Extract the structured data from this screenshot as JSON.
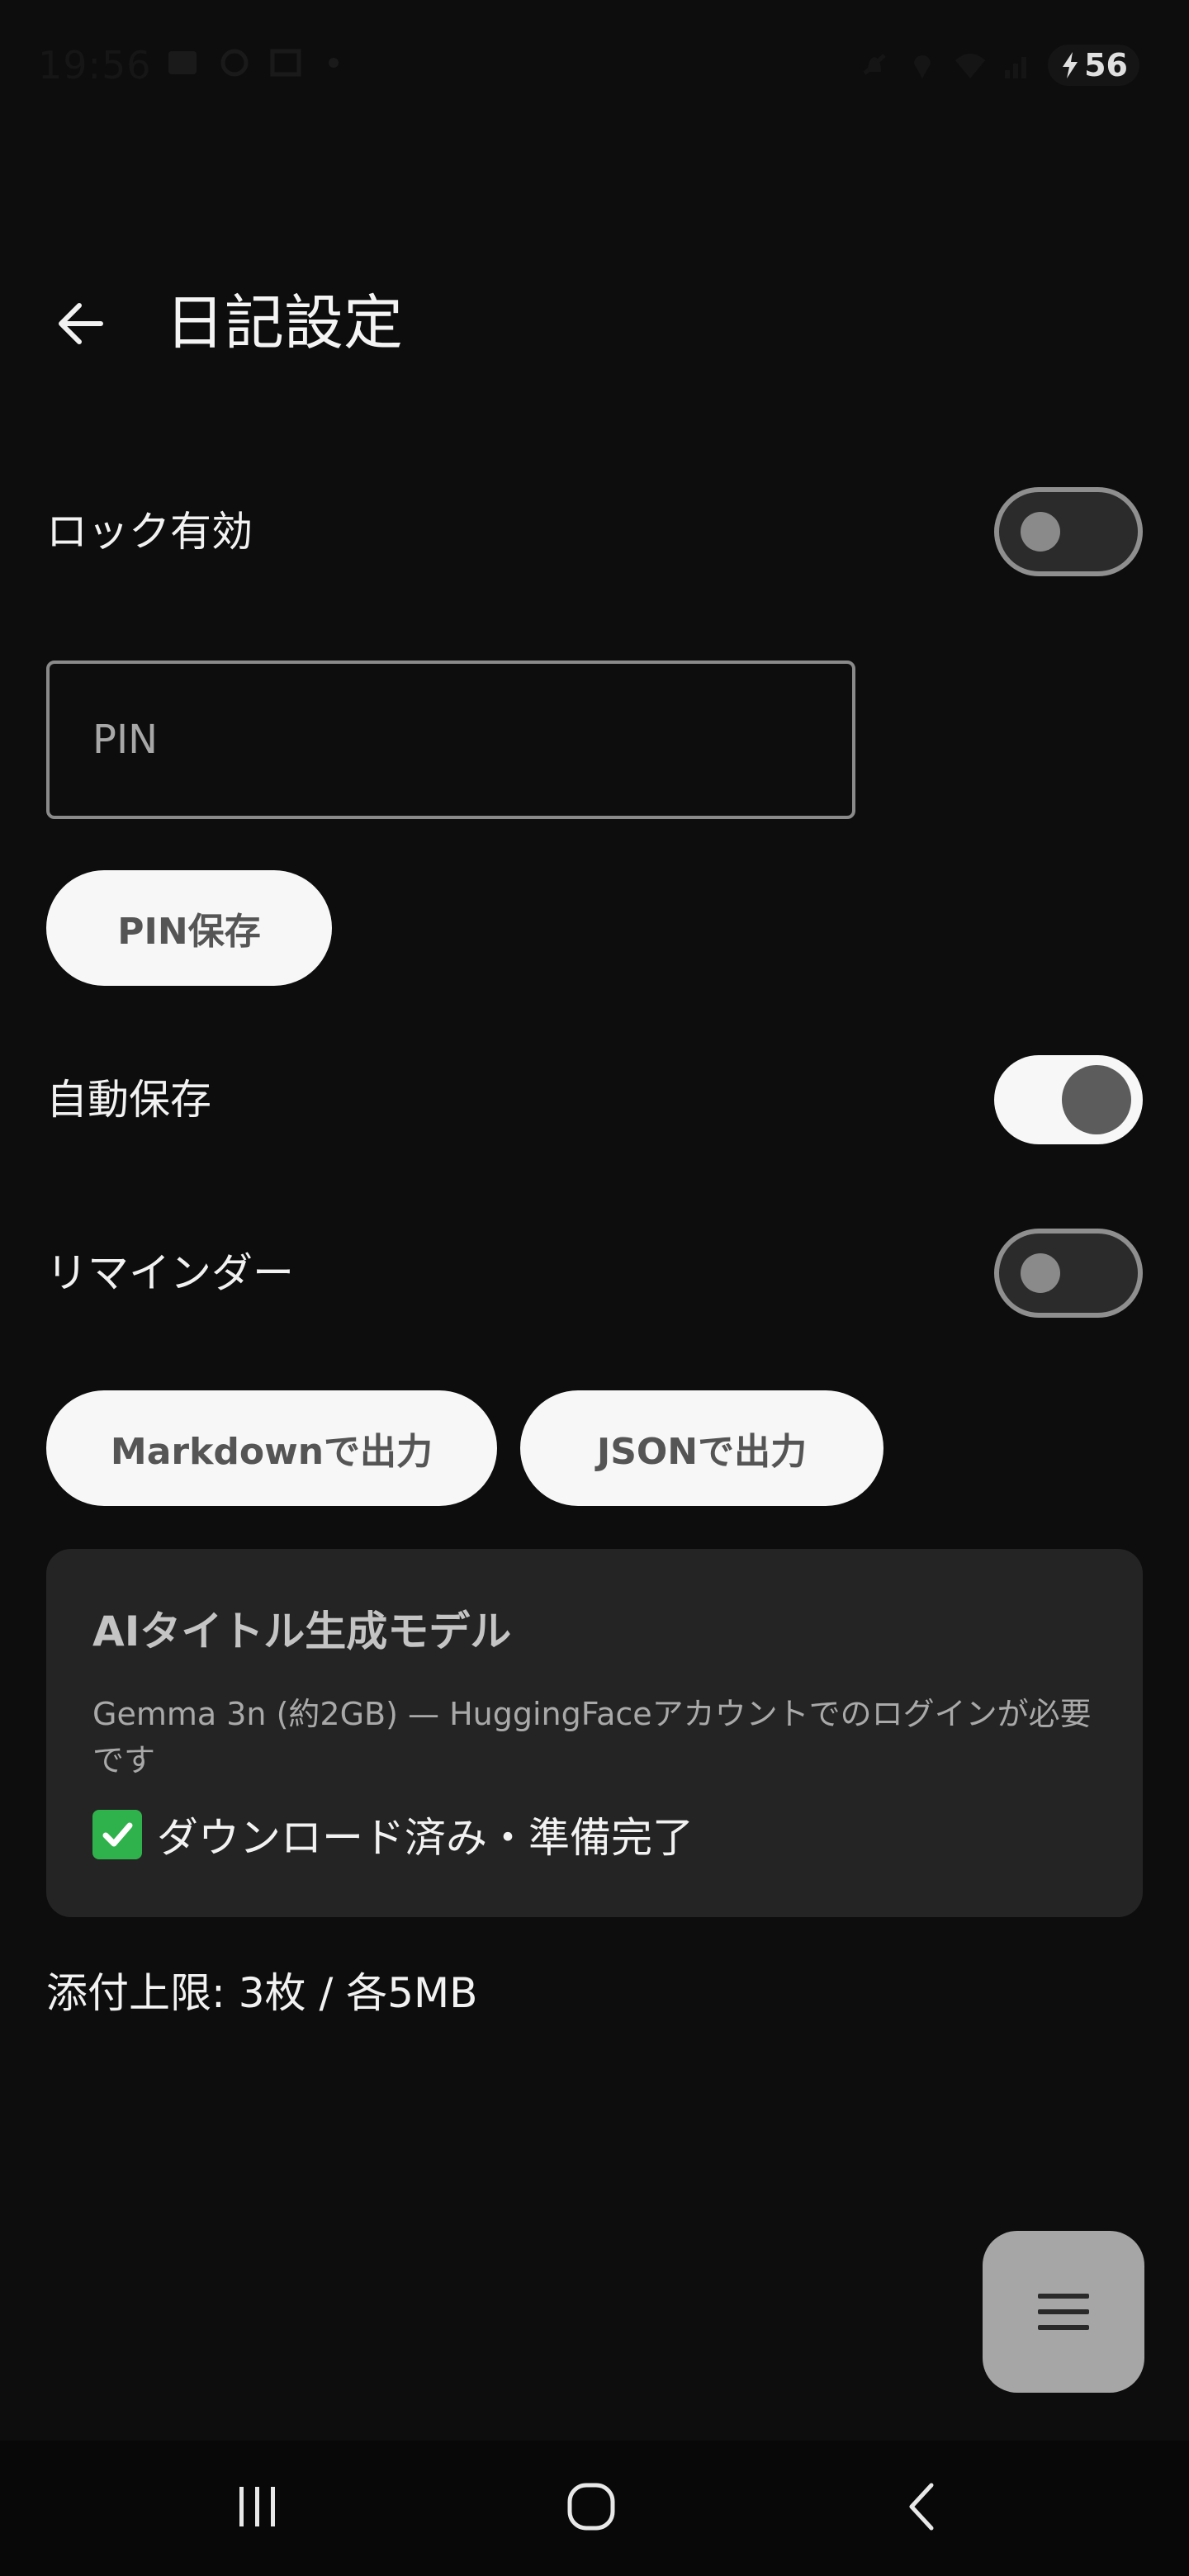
{
  "status_bar": {
    "time": "19:56",
    "battery_level": "56",
    "icons": [
      "gallery-icon",
      "sync-icon",
      "screenshot-icon",
      "mute-icon",
      "location-icon",
      "wifi-icon",
      "signal-icon",
      "charging-icon"
    ]
  },
  "header": {
    "title": "日記設定",
    "back_icon": "arrow-left-icon"
  },
  "settings": {
    "lock_label": "ロック有効",
    "lock_enabled": false,
    "pin_placeholder": "PIN",
    "pin_value": "",
    "pin_save_label": "PIN保存",
    "auto_save_label": "自動保存",
    "auto_save_enabled": true,
    "reminder_label": "リマインダー",
    "reminder_enabled": false,
    "export_markdown_label": "Markdownで出力",
    "export_json_label": "JSONで出力"
  },
  "ai_card": {
    "title": "AIタイトル生成モデル",
    "description": "Gemma 3n (約2GB) — HuggingFaceアカウントでのログインが必要です",
    "status_icon": "check-box-icon",
    "status": "ダウンロード済み・準備完了"
  },
  "attach_limit": "添付上限: 3枚 / 各5MB",
  "fab": {
    "icon": "menu-icon"
  },
  "nav_bar": {
    "icons": [
      "recent-apps-icon",
      "home-icon",
      "back-icon"
    ]
  },
  "colors": {
    "background": "#0d0d0d",
    "card": "#242424",
    "button": "#f7f7f7",
    "button_text": "#555555",
    "switch_on_track": "#f7f7f7",
    "switch_off_border": "#8f8f8f",
    "check": "#2fb24c",
    "fab": "#a6a6a6"
  }
}
